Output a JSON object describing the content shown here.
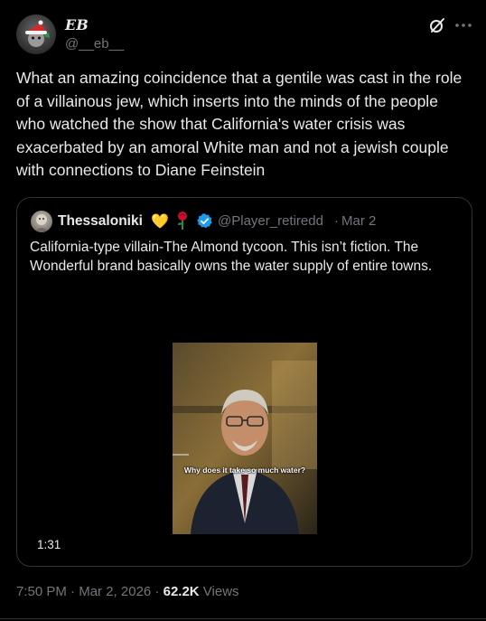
{
  "author": {
    "name": "EB",
    "handle": "@__eb__",
    "avatar_icon": "santa-hat-avatar"
  },
  "tweet": {
    "text": "What an amazing coincidence that a gentile was cast in the role of a villainous jew, which inserts into the minds of the people who watched the show that California's water crisis was exacerbated by an amoral White man and not a jewish couple with connections to Diane Feinstein"
  },
  "icons": {
    "grok": "grok-icon",
    "more": "more-icon",
    "verified_color": "#1d9bf0",
    "heart_color": "#ffcc33"
  },
  "quote": {
    "name": "Thessaloniki",
    "heart_emoji": "💛",
    "handle": "@Player_retiredd",
    "separator": "·",
    "date": "Mar 2",
    "text": "California-type villain-The Almond tycoon. This isn’t fiction. The Wonderful brand basically owns the water supply of entire towns.",
    "video": {
      "caption": "Why does it take so much water?",
      "duration": "1:31"
    }
  },
  "meta": {
    "time": "7:50 PM",
    "sep1": " · ",
    "date": "Mar 2, 2026",
    "sep2": " · ",
    "views_count": "62.2K",
    "views_label": " Views"
  }
}
